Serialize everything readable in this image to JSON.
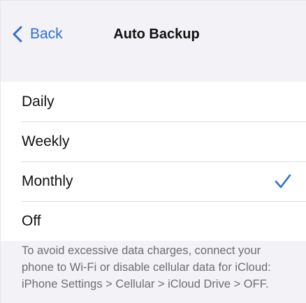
{
  "navbar": {
    "back_label": "Back",
    "title": "Auto Backup"
  },
  "options": [
    {
      "label": "Daily",
      "selected": false
    },
    {
      "label": "Weekly",
      "selected": false
    },
    {
      "label": "Monthly",
      "selected": true
    },
    {
      "label": "Off",
      "selected": false
    }
  ],
  "footer": {
    "note_line1": "To avoid excessive data charges, connect your",
    "note_line2": "phone to Wi-Fi or disable cellular data for iCloud:",
    "note_line3": "iPhone Settings > Cellular > iCloud Drive > OFF."
  },
  "colors": {
    "accent": "#2f6fd6",
    "background": "#f2f2f7",
    "text": "#111111",
    "secondary_text": "#6d6d72"
  },
  "icons": {
    "back": "chevron-left-icon",
    "selected": "checkmark-icon"
  }
}
